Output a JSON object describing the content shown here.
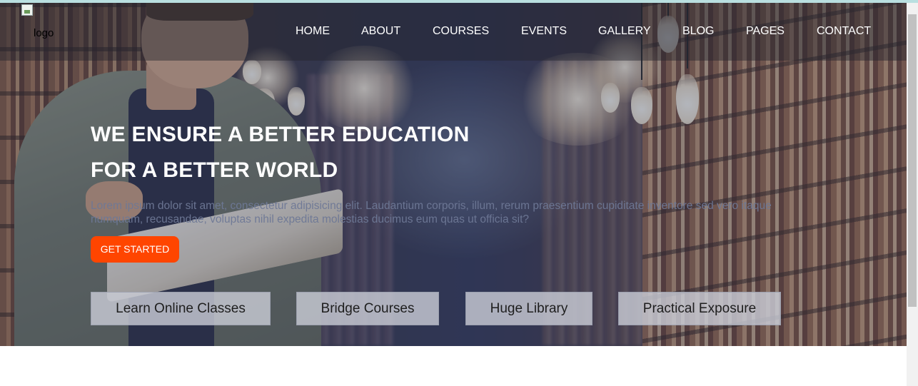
{
  "logo": {
    "alt": "logo"
  },
  "nav": {
    "items": [
      "HOME",
      "ABOUT",
      "COURSES",
      "EVENTS",
      "GALLERY",
      "BLOG",
      "PAGES",
      "CONTACT"
    ]
  },
  "hero": {
    "headline_line1": "WE ENSURE A BETTER EDUCATION",
    "headline_line2": "FOR A BETTER WORLD",
    "paragraph": "Lorem ipsum dolor sit amet, consectetur adipisicing elit. Laudantium corporis, illum, rerum praesentium cupiditate inventore sed vero itaque numquam, recusandae, voluptas nihil expedita molestias ducimus eum quas ut officia sit?",
    "cta_label": "GET STARTED"
  },
  "features": [
    "Learn Online Classes",
    "Bridge Courses",
    "Huge Library",
    "Practical Exposure"
  ],
  "colors": {
    "accent": "#ff4500",
    "topline": "#b9dfe0"
  }
}
